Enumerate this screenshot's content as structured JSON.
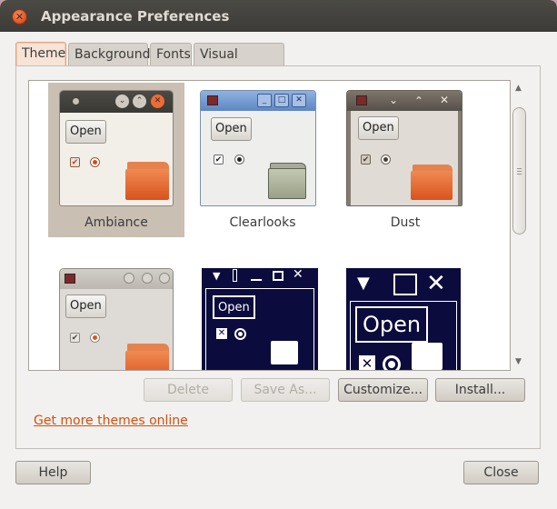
{
  "window": {
    "title": "Appearance Preferences"
  },
  "tabs": [
    {
      "label": "Theme",
      "active": true
    },
    {
      "label": "Background",
      "active": false
    },
    {
      "label": "Fonts",
      "active": false
    },
    {
      "label": "Visual Effects",
      "active": false
    }
  ],
  "themes": [
    {
      "name": "Ambiance",
      "selected": true,
      "preview_button": "Open"
    },
    {
      "name": "Clearlooks",
      "selected": false,
      "preview_button": "Open"
    },
    {
      "name": "Dust",
      "selected": false,
      "preview_button": "Open"
    },
    {
      "name": "",
      "selected": false,
      "preview_button": "Open"
    },
    {
      "name": "",
      "selected": false,
      "preview_button": "Open"
    },
    {
      "name": "",
      "selected": false,
      "preview_button": "Open"
    }
  ],
  "actions": {
    "delete": "Delete",
    "save_as": "Save As...",
    "customize": "Customize...",
    "install": "Install..."
  },
  "link": {
    "more_themes": "Get more themes online"
  },
  "footer": {
    "help": "Help",
    "close": "Close"
  },
  "colors": {
    "accent": "#d5500b",
    "titlebar": "#3c3b37",
    "selection": "#c9bfb3"
  }
}
